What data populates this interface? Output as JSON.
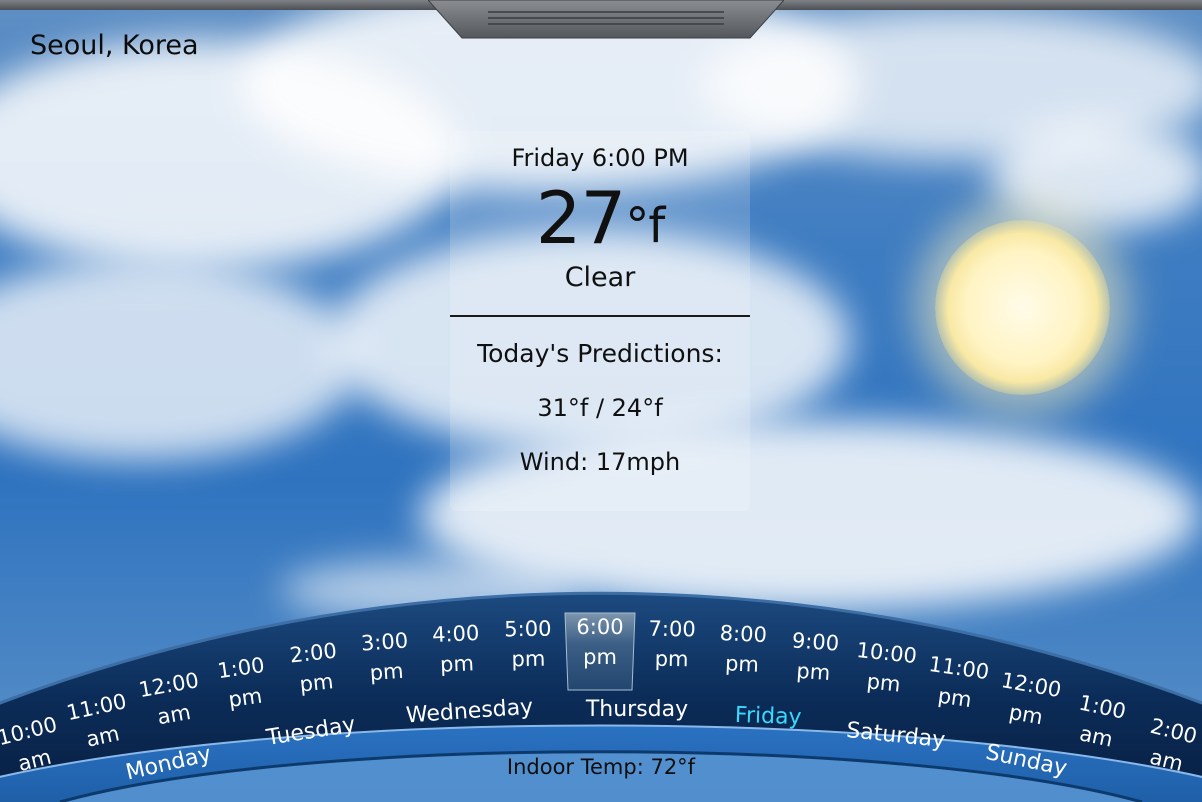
{
  "location": "Seoul, Korea",
  "current": {
    "datetime": "Friday 6:00 PM",
    "temperature": "27",
    "unit": "°f",
    "condition": "Clear"
  },
  "predictions": {
    "title": "Today's Predictions:",
    "range": "31°f / 24°f",
    "wind": "Wind: 17mph"
  },
  "hours": [
    {
      "time": "10:00",
      "period": "am"
    },
    {
      "time": "11:00",
      "period": "am"
    },
    {
      "time": "12:00",
      "period": "am"
    },
    {
      "time": "1:00",
      "period": "pm"
    },
    {
      "time": "2:00",
      "period": "pm"
    },
    {
      "time": "3:00",
      "period": "pm"
    },
    {
      "time": "4:00",
      "period": "pm"
    },
    {
      "time": "5:00",
      "period": "pm"
    },
    {
      "time": "6:00",
      "period": "pm",
      "selected": true
    },
    {
      "time": "7:00",
      "period": "pm"
    },
    {
      "time": "8:00",
      "period": "pm"
    },
    {
      "time": "9:00",
      "period": "pm"
    },
    {
      "time": "10:00",
      "period": "pm"
    },
    {
      "time": "11:00",
      "period": "pm"
    },
    {
      "time": "12:00",
      "period": "pm"
    },
    {
      "time": "1:00",
      "period": "am"
    },
    {
      "time": "2:00",
      "period": "am"
    }
  ],
  "days": [
    {
      "label": "Monday"
    },
    {
      "label": "Tuesday"
    },
    {
      "label": "Wednesday"
    },
    {
      "label": "Thursday"
    },
    {
      "label": "Friday",
      "active": true
    },
    {
      "label": "Saturday"
    },
    {
      "label": "Sunday"
    }
  ],
  "indoor": "Indoor Temp: 72°f",
  "colors": {
    "sky": "#2f73bf",
    "dial_outer": "#0b2f5e",
    "dial_band": "#2e78c8",
    "active_day": "#39d8ff",
    "sun": "#fff4c4"
  }
}
